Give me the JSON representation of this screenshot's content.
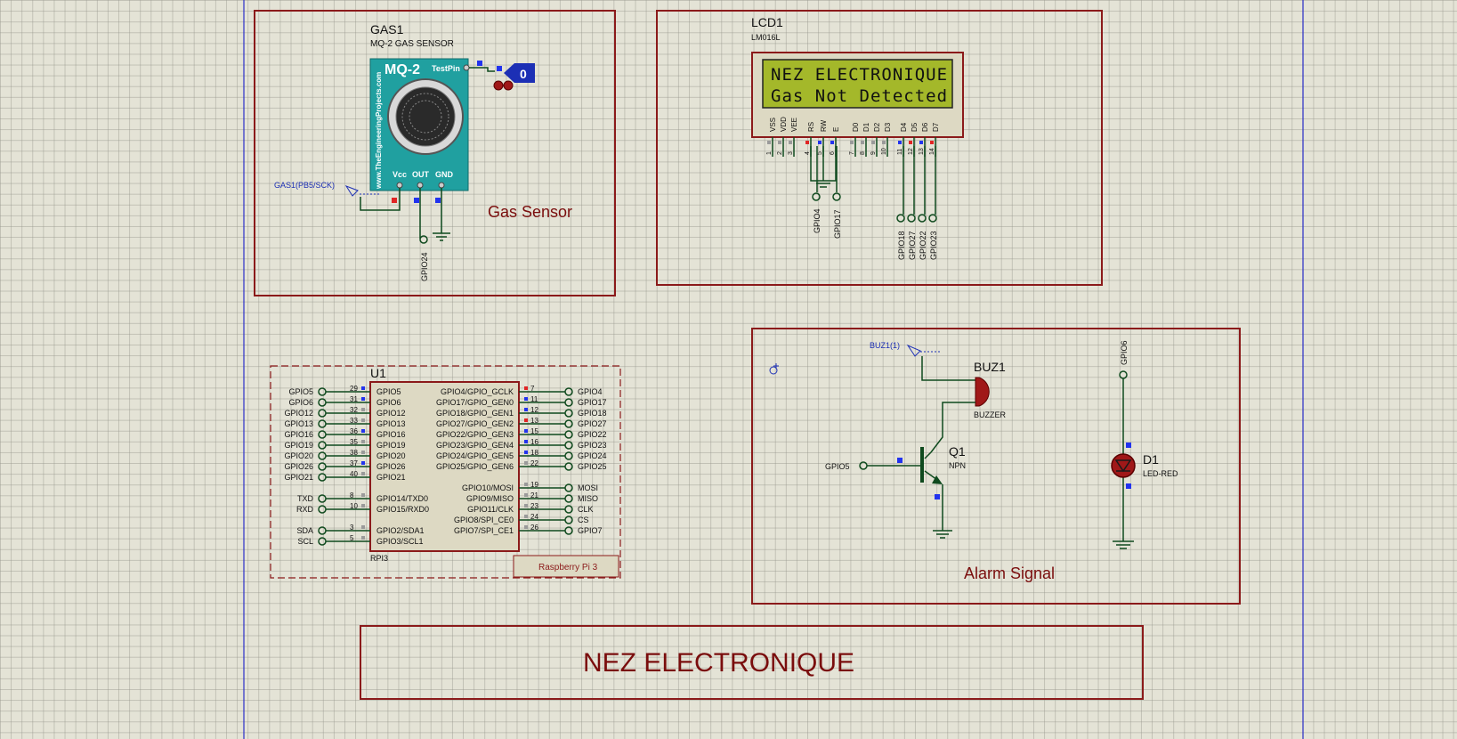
{
  "gas": {
    "ref": "GAS1",
    "part": "MQ-2 GAS SENSOR",
    "module_title": "MQ-2",
    "testpin": "TestPin",
    "vcc": "Vcc",
    "out": "OUT",
    "gnd": "GND",
    "side_text": "www.TheEngineeringProjects.com",
    "probe_value": "0",
    "netlabel": "GAS1(PB5/SCK)",
    "terminal": "GPIO24",
    "section_title": "Gas Sensor"
  },
  "lcd": {
    "ref": "LCD1",
    "part": "LM016L",
    "line1": "NEZ ELECTRONIQUE",
    "line2": "Gas Not Detected",
    "pins": [
      "VSS",
      "VDD",
      "VEE",
      "RS",
      "RW",
      "E",
      "D0",
      "D1",
      "D2",
      "D3",
      "D4",
      "D5",
      "D6",
      "D7"
    ],
    "pin_numbers": [
      "1",
      "2",
      "3",
      "4",
      "5",
      "6",
      "7",
      "8",
      "9",
      "10",
      "11",
      "12",
      "13",
      "14"
    ],
    "terminals": [
      "GPIO4",
      "GPIO17",
      "GPIO18",
      "GPIO27",
      "GPIO22",
      "GPIO23"
    ]
  },
  "rpi": {
    "ref": "U1",
    "part": "RPI3",
    "footer": "Raspberry Pi 3",
    "left_pins": [
      {
        "ext": "GPIO5",
        "num": "29",
        "inner": "GPIO5"
      },
      {
        "ext": "GPIO6",
        "num": "31",
        "inner": "GPIO6"
      },
      {
        "ext": "GPIO12",
        "num": "32",
        "inner": "GPIO12"
      },
      {
        "ext": "GPIO13",
        "num": "33",
        "inner": "GPIO13"
      },
      {
        "ext": "GPIO16",
        "num": "36",
        "inner": "GPIO16"
      },
      {
        "ext": "GPIO19",
        "num": "35",
        "inner": "GPIO19"
      },
      {
        "ext": "GPIO20",
        "num": "38",
        "inner": "GPIO20"
      },
      {
        "ext": "GPIO26",
        "num": "37",
        "inner": "GPIO26"
      },
      {
        "ext": "GPIO21",
        "num": "40",
        "inner": "GPIO21"
      },
      {
        "ext": "TXD",
        "num": "8",
        "inner": "GPIO14/TXD0"
      },
      {
        "ext": "RXD",
        "num": "10",
        "inner": "GPIO15/RXD0"
      },
      {
        "ext": "SDA",
        "num": "3",
        "inner": "GPIO2/SDA1"
      },
      {
        "ext": "SCL",
        "num": "5",
        "inner": "GPIO3/SCL1"
      }
    ],
    "right_pins": [
      {
        "ext": "GPIO4",
        "num": "7",
        "inner": "GPIO4/GPIO_GCLK"
      },
      {
        "ext": "GPIO17",
        "num": "11",
        "inner": "GPIO17/GPIO_GEN0"
      },
      {
        "ext": "GPIO18",
        "num": "12",
        "inner": "GPIO18/GPIO_GEN1"
      },
      {
        "ext": "GPIO27",
        "num": "13",
        "inner": "GPIO27/GPIO_GEN2"
      },
      {
        "ext": "GPIO22",
        "num": "15",
        "inner": "GPIO22/GPIO_GEN3"
      },
      {
        "ext": "GPIO23",
        "num": "16",
        "inner": "GPIO23/GPIO_GEN4"
      },
      {
        "ext": "GPIO24",
        "num": "18",
        "inner": "GPIO24/GPIO_GEN5"
      },
      {
        "ext": "GPIO25",
        "num": "22",
        "inner": "GPIO25/GPIO_GEN6"
      },
      {
        "ext": "MOSI",
        "num": "19",
        "inner": "GPIO10/MOSI"
      },
      {
        "ext": "MISO",
        "num": "21",
        "inner": "GPIO9/MISO"
      },
      {
        "ext": "CLK",
        "num": "23",
        "inner": "GPIO11/CLK"
      },
      {
        "ext": "CS",
        "num": "24",
        "inner": "GPIO8/SPI_CE0"
      },
      {
        "ext": "GPIO7",
        "num": "26",
        "inner": "GPIO7/SPI_CE1"
      }
    ]
  },
  "alarm": {
    "buzzer_ref": "BUZ1",
    "buzzer_part": "BUZZER",
    "buzzer_net": "BUZ1(1)",
    "q_ref": "Q1",
    "q_part": "NPN",
    "q_terminal": "GPIO5",
    "led_ref": "D1",
    "led_part": "LED-RED",
    "led_terminal": "GPIO6",
    "section_title": "Alarm Signal"
  },
  "footer_title": "NEZ ELECTRONIQUE",
  "colors": {
    "wire": "#0f4a1e",
    "frame": "#8b1a1a",
    "label": "#7a0d0d",
    "netlabel": "#1c2fb5",
    "lcd_bg": "#a4b82a",
    "mq2": "#20a0a0"
  }
}
